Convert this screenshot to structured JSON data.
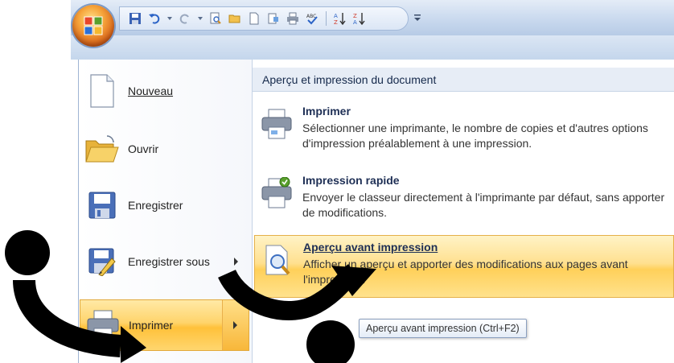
{
  "quick_access_toolbar": {
    "icons": [
      "save-icon",
      "undo-icon",
      "redo-icon",
      "print-preview-icon",
      "open-icon",
      "new-icon",
      "publish-icon",
      "quick-print-icon",
      "spelling-icon",
      "sort-ascending-icon",
      "sort-descending-icon"
    ]
  },
  "menu": {
    "items": [
      {
        "label": "Nouveau",
        "icon": "new-document-icon"
      },
      {
        "label": "Ouvrir",
        "icon": "open-folder-icon"
      },
      {
        "label": "Enregistrer",
        "icon": "save-icon"
      },
      {
        "label": "Enregistrer sous",
        "icon": "save-as-icon"
      },
      {
        "label": "Imprimer",
        "icon": "printer-icon"
      }
    ]
  },
  "panel": {
    "header": "Aperçu et impression du document",
    "items": [
      {
        "title": "Imprimer",
        "description": "Sélectionner une imprimante, le nombre de copies et d'autres options d'impression préalablement à une impression.",
        "icon": "printer-icon"
      },
      {
        "title": "Impression rapide",
        "description": "Envoyer le classeur directement à l'imprimante par défaut, sans apporter de modifications.",
        "icon": "quick-print-icon"
      },
      {
        "title": "Aperçu avant impression",
        "description": "Afficher un aperçu et apporter des modifications aux pages avant l'impression.",
        "icon": "print-preview-icon"
      }
    ]
  },
  "tooltip": "Aperçu avant impression (Ctrl+F2)",
  "colors": {
    "highlight": "#ffd46b",
    "panel_header_bg": "#e7edf6",
    "title_bar": "#c9d9ee"
  }
}
